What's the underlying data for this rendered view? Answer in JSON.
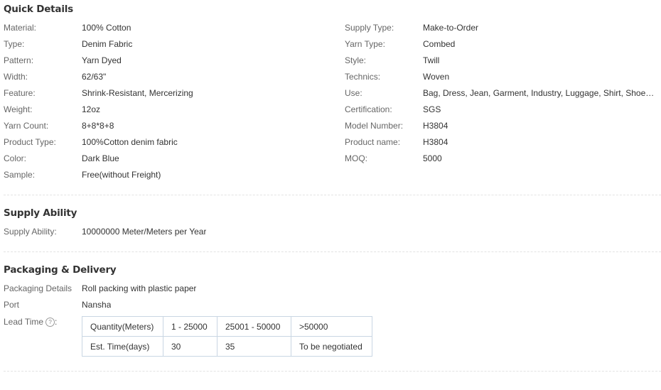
{
  "quick_details": {
    "title": "Quick Details",
    "left": [
      {
        "label": "Material:",
        "value": "100% Cotton"
      },
      {
        "label": "Type:",
        "value": "Denim Fabric"
      },
      {
        "label": "Pattern:",
        "value": "Yarn Dyed"
      },
      {
        "label": "Width:",
        "value": "62/63\""
      },
      {
        "label": "Feature:",
        "value": "Shrink-Resistant, Mercerizing"
      },
      {
        "label": "Weight:",
        "value": "12oz"
      },
      {
        "label": "Yarn Count:",
        "value": "8+8*8+8"
      },
      {
        "label": "Product Type:",
        "value": "100%Cotton denim fabric"
      },
      {
        "label": "Color:",
        "value": "Dark Blue"
      },
      {
        "label": "Sample:",
        "value": "Free(without Freight)"
      }
    ],
    "right": [
      {
        "label": "Supply Type:",
        "value": "Make-to-Order"
      },
      {
        "label": "Yarn Type:",
        "value": "Combed"
      },
      {
        "label": "Style:",
        "value": "Twill"
      },
      {
        "label": "Technics:",
        "value": "Woven"
      },
      {
        "label": "Use:",
        "value": "Bag, Dress, Jean, Garment, Industry, Luggage, Shirt, Shoes, Sof…"
      },
      {
        "label": "Certification:",
        "value": "SGS"
      },
      {
        "label": "Model Number:",
        "value": "H3804"
      },
      {
        "label": "Product name:",
        "value": "H3804"
      },
      {
        "label": "MOQ:",
        "value": "5000"
      }
    ]
  },
  "supply_ability": {
    "title": "Supply Ability",
    "label": "Supply Ability:",
    "value": "10000000 Meter/Meters per Year"
  },
  "packaging": {
    "title": "Packaging & Delivery",
    "details_label": "Packaging Details",
    "details_value": "Roll packing with plastic paper",
    "port_label": "Port",
    "port_value": "Nansha",
    "lead_time_label": "Lead Time",
    "lead_time_icon": "?",
    "lead_table": {
      "header": [
        "Quantity(Meters)",
        "1 - 25000",
        "25001 - 50000",
        ">50000"
      ],
      "row": [
        "Est. Time(days)",
        "30",
        "35",
        "To be negotiated"
      ]
    }
  }
}
